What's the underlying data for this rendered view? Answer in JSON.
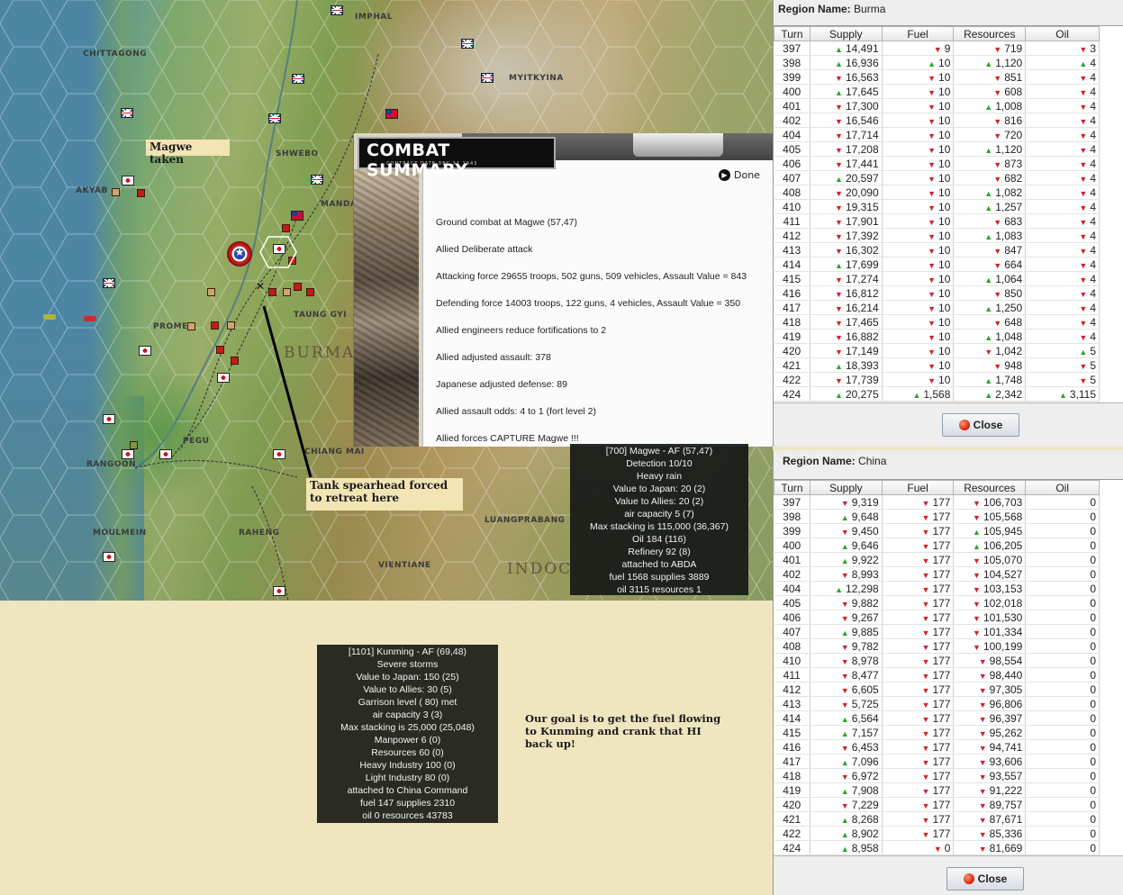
{
  "map": {
    "places": {
      "imphal": "IMPHAL",
      "chittagong": "CHITTAGONG",
      "myitkyina": "MYITKYINA",
      "shwebo": "SHWEBO",
      "akyab": "AKYAB",
      "mandalay": "MANDA",
      "prome": "PROME",
      "taung_gyi": "TAUNG GYI",
      "burma": "BURMA",
      "pegu": "PEGU",
      "rangoon": "RANGOON",
      "chiang_mai": "CHIANG MAI",
      "moulmein": "MOULMEIN",
      "raheng": "RAHENG",
      "luangprabang": "LUANGPRABANG",
      "vientiane": "VIENTIANE",
      "indochina": "INDOC"
    },
    "note_magwe": "Magwe taken",
    "note_tank": "Tank spearhead forced to retreat here",
    "colors": {
      "sea": "#4d86a4",
      "land": "#9bae6a",
      "highlight_hex": "#ffffff"
    }
  },
  "combat": {
    "title": "COMBAT SUMMARY",
    "subtitle": "CONTRACT DATE DEC 31 1943",
    "done_label": "Done",
    "lines": [
      "Ground combat at Magwe (57,47)",
      "Allied Deliberate attack",
      "Attacking force 29655 troops, 502 guns, 509 vehicles, Assault Value = 843",
      "Defending force 14003 troops, 122 guns, 4 vehicles, Assault Value = 350",
      "Allied engineers reduce fortifications to 2",
      "Allied adjusted assault: 378",
      "Japanese adjusted defense: 89",
      "Allied assault odds: 4 to 1 (fort level 2)",
      "Allied forces CAPTURE Magwe !!!"
    ]
  },
  "tooltip_magwe": {
    "lines": [
      "[700] Magwe - AF (57,47)",
      "Detection 10/10",
      "Heavy rain",
      "Value to Japan: 20 (2)",
      "Value to Allies: 20 (2)",
      "air capacity 5 (7)",
      "Max stacking is 115,000 (36,367)",
      "Oil 184 (116)",
      "Refinery 92 (8)",
      "attached to ABDA",
      "fuel 1568 supplies 3889",
      "oil 3115 resources 1"
    ]
  },
  "tooltip_kunming": {
    "lines": [
      "[1101] Kunming - AF (69,48)",
      "Severe storms",
      "Value to Japan: 150 (25)",
      "Value to Allies: 30 (5)",
      "Garrison level ( 80) met",
      "air capacity 3 (3)",
      "Max stacking is 25,000 (25,048)",
      "Manpower 6 (0)",
      "Resources 60 (0)",
      "Heavy Industry 100 (0)",
      "Light Industry 80 (0)",
      "attached to China Command",
      "fuel 147 supplies 2310",
      "oil 0 resources 43783"
    ]
  },
  "goal_note": "Our goal is to get the fuel flowing to Kunming and crank that HI back up!",
  "burma": {
    "region_label": "Region Name:",
    "region_name": "Burma",
    "columns": [
      "Turn",
      "Supply",
      "Fuel",
      "Resources",
      "Oil"
    ],
    "close_label": "Close",
    "rows": [
      [
        "397",
        "up",
        "14,491",
        "dn",
        "9",
        "dn",
        "719",
        "dn",
        "3"
      ],
      [
        "398",
        "up",
        "16,936",
        "up",
        "10",
        "up",
        "1,120",
        "up",
        "4"
      ],
      [
        "399",
        "dn",
        "16,563",
        "dn",
        "10",
        "dn",
        "851",
        "dn",
        "4"
      ],
      [
        "400",
        "up",
        "17,645",
        "dn",
        "10",
        "dn",
        "608",
        "dn",
        "4"
      ],
      [
        "401",
        "dn",
        "17,300",
        "dn",
        "10",
        "up",
        "1,008",
        "dn",
        "4"
      ],
      [
        "402",
        "dn",
        "16,546",
        "dn",
        "10",
        "dn",
        "816",
        "dn",
        "4"
      ],
      [
        "404",
        "dn",
        "17,714",
        "dn",
        "10",
        "dn",
        "720",
        "dn",
        "4"
      ],
      [
        "405",
        "dn",
        "17,208",
        "dn",
        "10",
        "up",
        "1,120",
        "dn",
        "4"
      ],
      [
        "406",
        "dn",
        "17,441",
        "dn",
        "10",
        "dn",
        "873",
        "dn",
        "4"
      ],
      [
        "407",
        "up",
        "20,597",
        "dn",
        "10",
        "dn",
        "682",
        "dn",
        "4"
      ],
      [
        "408",
        "dn",
        "20,090",
        "dn",
        "10",
        "up",
        "1,082",
        "dn",
        "4"
      ],
      [
        "410",
        "dn",
        "19,315",
        "dn",
        "10",
        "up",
        "1,257",
        "dn",
        "4"
      ],
      [
        "411",
        "dn",
        "17,901",
        "dn",
        "10",
        "dn",
        "683",
        "dn",
        "4"
      ],
      [
        "412",
        "dn",
        "17,392",
        "dn",
        "10",
        "up",
        "1,083",
        "dn",
        "4"
      ],
      [
        "413",
        "dn",
        "16,302",
        "dn",
        "10",
        "dn",
        "847",
        "dn",
        "4"
      ],
      [
        "414",
        "up",
        "17,699",
        "dn",
        "10",
        "dn",
        "664",
        "dn",
        "4"
      ],
      [
        "415",
        "dn",
        "17,274",
        "dn",
        "10",
        "up",
        "1,064",
        "dn",
        "4"
      ],
      [
        "416",
        "dn",
        "16,812",
        "dn",
        "10",
        "dn",
        "850",
        "dn",
        "4"
      ],
      [
        "417",
        "dn",
        "16,214",
        "dn",
        "10",
        "up",
        "1,250",
        "dn",
        "4"
      ],
      [
        "418",
        "dn",
        "17,465",
        "dn",
        "10",
        "dn",
        "648",
        "dn",
        "4"
      ],
      [
        "419",
        "dn",
        "16,882",
        "dn",
        "10",
        "up",
        "1,048",
        "dn",
        "4"
      ],
      [
        "420",
        "dn",
        "17,149",
        "dn",
        "10",
        "dn",
        "1,042",
        "up",
        "5"
      ],
      [
        "421",
        "up",
        "18,393",
        "dn",
        "10",
        "dn",
        "948",
        "dn",
        "5"
      ],
      [
        "422",
        "dn",
        "17,739",
        "dn",
        "10",
        "up",
        "1,748",
        "dn",
        "5"
      ],
      [
        "424",
        "up",
        "20,275",
        "up",
        "1,568",
        "up",
        "2,342",
        "up",
        "3,115"
      ]
    ]
  },
  "china": {
    "region_label": "Region Name:",
    "region_name": "China",
    "columns": [
      "Turn",
      "Supply",
      "Fuel",
      "Resources",
      "Oil"
    ],
    "close_label": "Close",
    "rows": [
      [
        "397",
        "dn",
        "9,319",
        "dn",
        "177",
        "dn",
        "106,703",
        "",
        "0"
      ],
      [
        "398",
        "up",
        "9,648",
        "dn",
        "177",
        "dn",
        "105,568",
        "",
        "0"
      ],
      [
        "399",
        "dn",
        "9,450",
        "dn",
        "177",
        "up",
        "105,945",
        "",
        "0"
      ],
      [
        "400",
        "up",
        "9,646",
        "dn",
        "177",
        "up",
        "106,205",
        "",
        "0"
      ],
      [
        "401",
        "up",
        "9,922",
        "dn",
        "177",
        "dn",
        "105,070",
        "",
        "0"
      ],
      [
        "402",
        "dn",
        "8,993",
        "dn",
        "177",
        "dn",
        "104,527",
        "",
        "0"
      ],
      [
        "404",
        "up",
        "12,298",
        "dn",
        "177",
        "dn",
        "103,153",
        "",
        "0"
      ],
      [
        "405",
        "dn",
        "9,882",
        "dn",
        "177",
        "dn",
        "102,018",
        "",
        "0"
      ],
      [
        "406",
        "dn",
        "9,267",
        "dn",
        "177",
        "dn",
        "101,530",
        "",
        "0"
      ],
      [
        "407",
        "up",
        "9,885",
        "dn",
        "177",
        "dn",
        "101,334",
        "",
        "0"
      ],
      [
        "408",
        "dn",
        "9,782",
        "dn",
        "177",
        "dn",
        "100,199",
        "",
        "0"
      ],
      [
        "410",
        "dn",
        "8,978",
        "dn",
        "177",
        "dn",
        "98,554",
        "",
        "0"
      ],
      [
        "411",
        "dn",
        "8,477",
        "dn",
        "177",
        "dn",
        "98,440",
        "",
        "0"
      ],
      [
        "412",
        "dn",
        "6,605",
        "dn",
        "177",
        "dn",
        "97,305",
        "",
        "0"
      ],
      [
        "413",
        "dn",
        "5,725",
        "dn",
        "177",
        "dn",
        "96,806",
        "",
        "0"
      ],
      [
        "414",
        "up",
        "6,564",
        "dn",
        "177",
        "dn",
        "96,397",
        "",
        "0"
      ],
      [
        "415",
        "up",
        "7,157",
        "dn",
        "177",
        "dn",
        "95,262",
        "",
        "0"
      ],
      [
        "416",
        "dn",
        "6,453",
        "dn",
        "177",
        "dn",
        "94,741",
        "",
        "0"
      ],
      [
        "417",
        "up",
        "7,096",
        "dn",
        "177",
        "dn",
        "93,606",
        "",
        "0"
      ],
      [
        "418",
        "dn",
        "6,972",
        "dn",
        "177",
        "dn",
        "93,557",
        "",
        "0"
      ],
      [
        "419",
        "up",
        "7,908",
        "dn",
        "177",
        "dn",
        "91,222",
        "",
        "0"
      ],
      [
        "420",
        "dn",
        "7,229",
        "dn",
        "177",
        "dn",
        "89,757",
        "",
        "0"
      ],
      [
        "421",
        "up",
        "8,268",
        "dn",
        "177",
        "dn",
        "87,671",
        "",
        "0"
      ],
      [
        "422",
        "up",
        "8,902",
        "dn",
        "177",
        "dn",
        "85,336",
        "",
        "0"
      ],
      [
        "424",
        "up",
        "8,958",
        "dn",
        "0",
        "dn",
        "81,669",
        "",
        "0"
      ]
    ]
  }
}
